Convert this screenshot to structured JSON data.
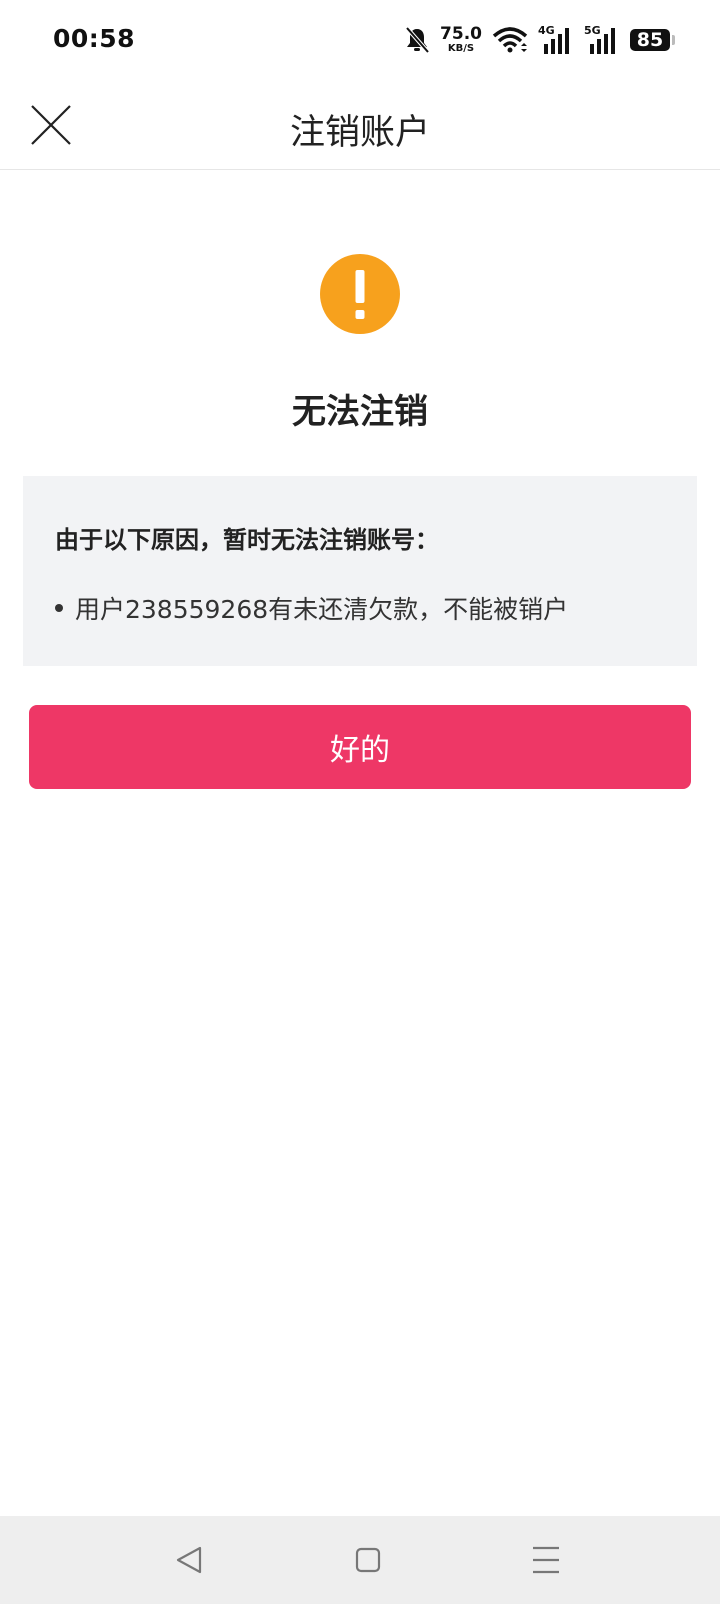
{
  "status_bar": {
    "time": "00:58",
    "net_speed_value": "75.0",
    "net_speed_unit": "KB/S",
    "signal_1_label": "4G",
    "signal_2_label": "5G",
    "battery_level": "85",
    "icons": [
      "bell-off-icon",
      "wifi-icon",
      "signal-4g-icon",
      "signal-5g-icon",
      "battery-icon"
    ]
  },
  "header": {
    "title": "注销账户",
    "close_icon": "close-icon"
  },
  "result": {
    "icon": "warning-icon",
    "icon_color": "#f7a11d",
    "title": "无法注销"
  },
  "reasons": {
    "heading": "由于以下原因，暂时无法注销账号：",
    "items": [
      "用户238559268有未还清欠款，不能被销户"
    ]
  },
  "action": {
    "ok_label": "好的",
    "ok_color": "#ee3766"
  },
  "system_nav": {
    "icons": [
      "back-icon",
      "home-icon",
      "menu-icon"
    ]
  }
}
